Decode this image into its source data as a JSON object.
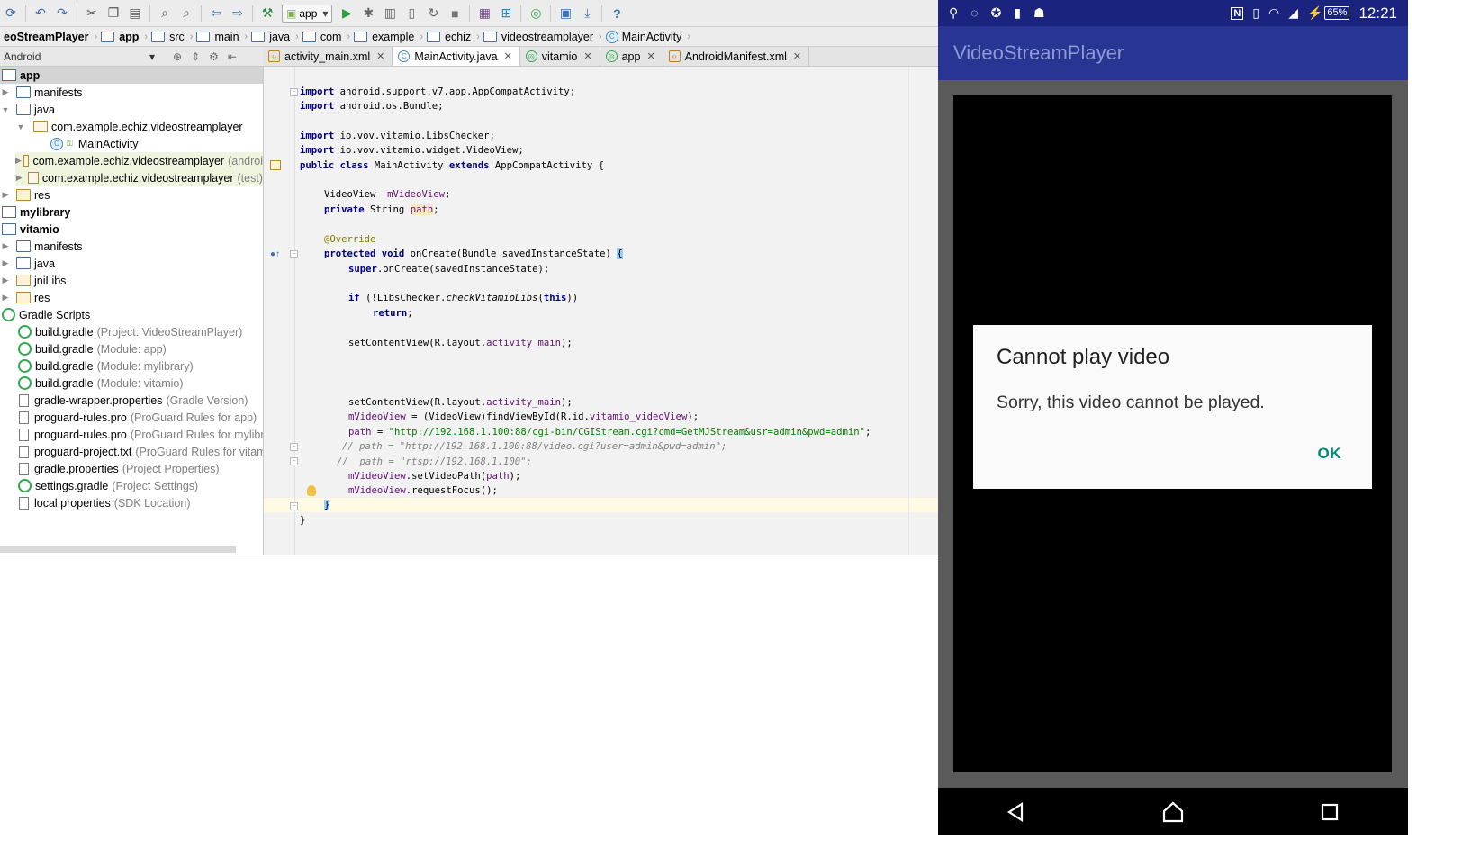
{
  "ide": {
    "toolbar": {
      "run_config": "app",
      "run_config_arrow": "▾"
    },
    "breadcrumbs": [
      "eoStreamPlayer",
      "app",
      "src",
      "main",
      "java",
      "com",
      "example",
      "echiz",
      "videostreamplayer",
      "MainActivity"
    ],
    "project_view": {
      "selector": "Android",
      "selector_arrow": "▾"
    },
    "tabs": [
      {
        "label": "activity_main.xml",
        "active": false
      },
      {
        "label": "MainActivity.java",
        "active": true
      },
      {
        "label": "vitamio",
        "active": false
      },
      {
        "label": "app",
        "active": false
      },
      {
        "label": "AndroidManifest.xml",
        "active": false
      }
    ],
    "tree": [
      {
        "name": "app",
        "hint": ""
      },
      {
        "name": "manifests",
        "hint": ""
      },
      {
        "name": "java",
        "hint": ""
      },
      {
        "name": "com.example.echiz.videostreamplayer",
        "hint": ""
      },
      {
        "name": "MainActivity",
        "hint": ""
      },
      {
        "name": "com.example.echiz.videostreamplayer",
        "hint": "(androi"
      },
      {
        "name": "com.example.echiz.videostreamplayer",
        "hint": "(test)"
      },
      {
        "name": "res",
        "hint": ""
      },
      {
        "name": "mylibrary",
        "hint": ""
      },
      {
        "name": "vitamio",
        "hint": ""
      },
      {
        "name": "manifests",
        "hint": ""
      },
      {
        "name": "java",
        "hint": ""
      },
      {
        "name": "jniLibs",
        "hint": ""
      },
      {
        "name": "res",
        "hint": ""
      },
      {
        "name": "Gradle Scripts",
        "hint": ""
      },
      {
        "name": "build.gradle",
        "hint": "(Project: VideoStreamPlayer)"
      },
      {
        "name": "build.gradle",
        "hint": "(Module: app)"
      },
      {
        "name": "build.gradle",
        "hint": "(Module: mylibrary)"
      },
      {
        "name": "build.gradle",
        "hint": "(Module: vitamio)"
      },
      {
        "name": "gradle-wrapper.properties",
        "hint": "(Gradle Version)"
      },
      {
        "name": "proguard-rules.pro",
        "hint": "(ProGuard Rules for app)"
      },
      {
        "name": "proguard-rules.pro",
        "hint": "(ProGuard Rules for mylibrary)"
      },
      {
        "name": "proguard-project.txt",
        "hint": "(ProGuard Rules for vitamio)"
      },
      {
        "name": "gradle.properties",
        "hint": "(Project Properties)"
      },
      {
        "name": "settings.gradle",
        "hint": "(Project Settings)"
      },
      {
        "name": "local.properties",
        "hint": "(SDK Location)"
      }
    ],
    "code": {
      "l1_kw": "import",
      "l1": " android.support.v7.app.AppCompatActivity;",
      "l2_kw": "import",
      "l2": " android.os.Bundle;",
      "l3_kw": "import",
      "l3": " io.vov.vitamio.LibsChecker;",
      "l4_kw": "import",
      "l4": " io.vov.vitamio.widget.VideoView;",
      "l5_kw1": "public class",
      "l5_a": " MainActivity ",
      "l5_kw2": "extends",
      "l5_b": " AppCompatActivity {",
      "l6_a": "VideoView  ",
      "l6_f": "mVideoView",
      "l6_b": ";",
      "l7_kw": "private",
      "l7_a": " String ",
      "l7_f": "path",
      "l7_b": ";",
      "l8_ann": "@Override",
      "l9_kw": "protected void",
      "l9_a": " onCreate(Bundle savedInstanceState) ",
      "l9_br": "{",
      "l10_kw": "super",
      "l10_a": ".onCreate(savedInstanceState);",
      "l11_kw": "if",
      "l11_a": " (!LibsChecker.",
      "l11_it": "checkVitamioLibs",
      "l11_b": "(",
      "l11_kw2": "this",
      "l11_c": "))",
      "l12_kw": "return",
      "l12_a": ";",
      "l13_a": "setContentView(R.layout.",
      "l13_f": "activity_main",
      "l13_b": ");",
      "l14_a": "setContentView(R.layout.",
      "l14_f": "activity_main",
      "l14_b": ");",
      "l15_f": "mVideoView",
      "l15_a": " = (VideoView)findViewById(R.id.",
      "l15_f2": "vitamio_videoView",
      "l15_b": ");",
      "l16_f": "path",
      "l16_a": " = ",
      "l16_s": "\"http://192.168.1.100:88/cgi-bin/CGIStream.cgi?cmd=GetMJStream&usr=admin&pwd=admin\"",
      "l16_b": ";",
      "l17_c": "// path = \"http://192.168.1.100:88/video.cgi?user=admin&pwd=admin\";",
      "l18_c": "//  path = \"rtsp://192.168.1.100\";",
      "l19_f": "mVideoView",
      "l19_a": ".setVideoPath(",
      "l19_f2": "path",
      "l19_b": ");",
      "l20_f": "mVideoView",
      "l20_a": ".requestFocus();",
      "l21_br": "}",
      "l22": "}"
    }
  },
  "phone": {
    "status": {
      "battery": "65%",
      "time": "12:21",
      "nfc": "N",
      "signal": "◢"
    },
    "app_title": "VideoStreamPlayer",
    "dialog": {
      "title": "Cannot play video",
      "message": "Sorry, this video cannot be played.",
      "ok": "OK"
    }
  }
}
